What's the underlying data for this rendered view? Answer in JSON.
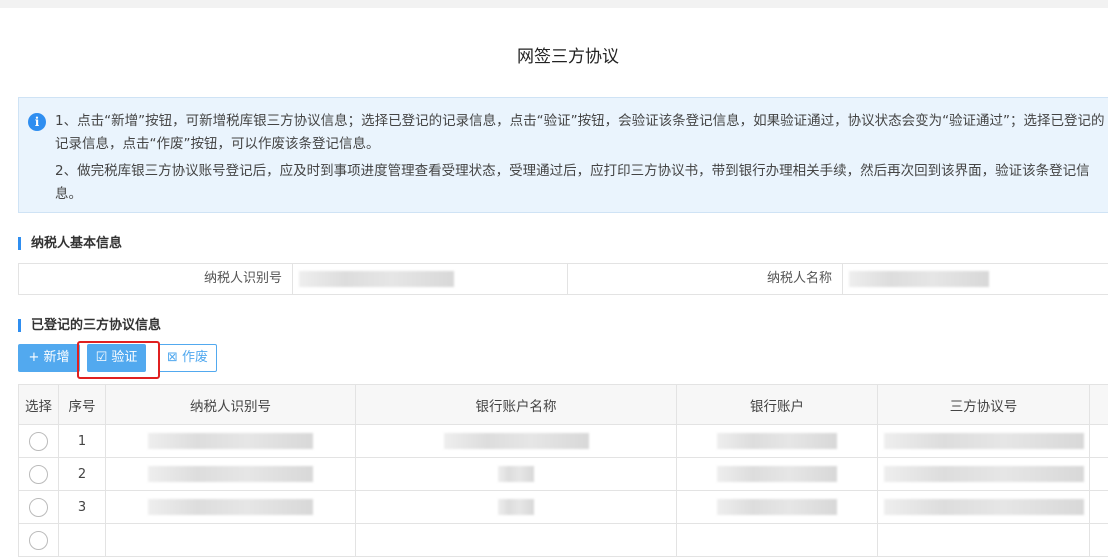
{
  "page": {
    "title": "网签三方协议"
  },
  "notice": {
    "icon": "info-icon",
    "line1": "1、点击“新增”按钮，可新增税库银三方协议信息；选择已登记的记录信息，点击“验证”按钮，会验证该条登记信息，如果验证通过，协议状态会变为“验证通过”；选择已登记的记录信息，点击“作废”按钮，可以作废该条登记信息。",
    "line2": "2、做完税库银三方协议账号登记后，应及时到事项进度管理查看受理状态，受理通过后，应打印三方协议书，带到银行办理相关手续，然后再次回到该界面，验证该条登记信息。"
  },
  "basic": {
    "heading": "纳税人基本信息",
    "id_label": "纳税人识别号",
    "name_label": "纳税人名称"
  },
  "registered": {
    "heading": "已登记的三方协议信息",
    "add": "+ 新增",
    "verify": "☑ 验证",
    "void": "⊠ 作废"
  },
  "table": {
    "headers": [
      "选择",
      "序号",
      "纳税人识别号",
      "银行账户名称",
      "银行账户",
      "三方协议号",
      ""
    ],
    "rows": [
      {
        "no": "1"
      },
      {
        "no": "2"
      },
      {
        "no": "3"
      },
      {
        "no": ""
      }
    ]
  },
  "colors": {
    "accent": "#52a9ef",
    "highlight": "#e02020"
  }
}
